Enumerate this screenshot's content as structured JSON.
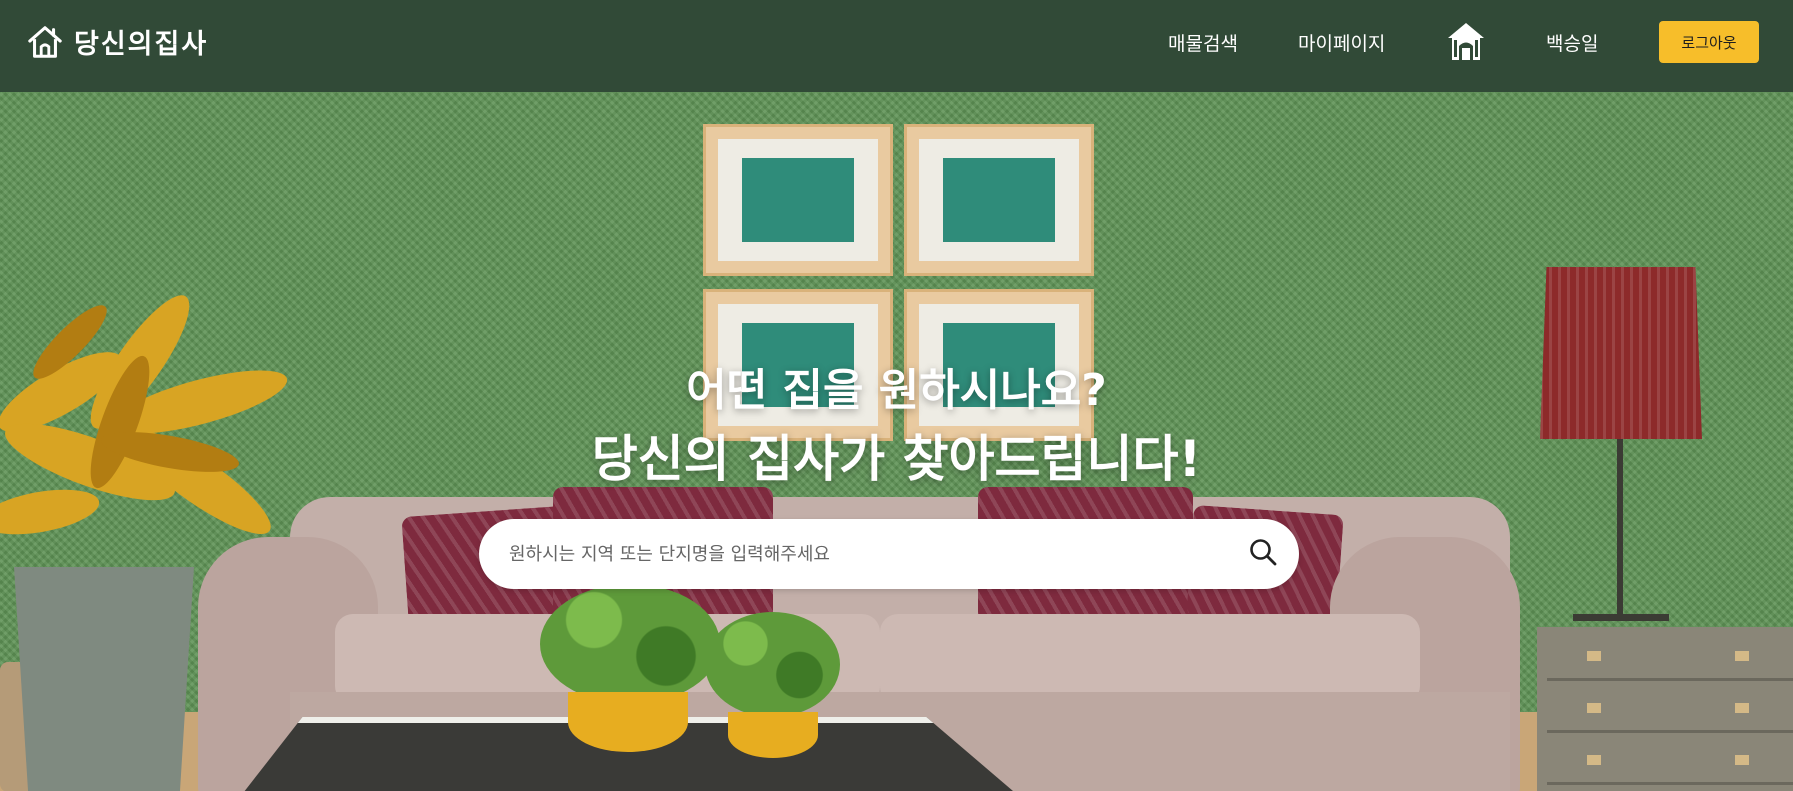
{
  "brand": {
    "name": "당신의집사"
  },
  "nav": {
    "items": [
      "매물검색",
      "마이페이지"
    ],
    "user_name": "백승일",
    "logout_label": "로그아웃"
  },
  "hero": {
    "headline_line1": "어떤 집을 원하시나요?",
    "headline_line2": "당신의 집사가 찾아드립니다!",
    "search_placeholder": "원하시는 지역 또는 단지명을 입력해주세요"
  },
  "colors": {
    "header_bg": "#314a37",
    "accent": "#f7be2a",
    "text_on_dark": "#ffffff"
  },
  "icons": {
    "brand": "house-outline-icon",
    "nav_home": "house-icon",
    "search": "search-icon"
  }
}
